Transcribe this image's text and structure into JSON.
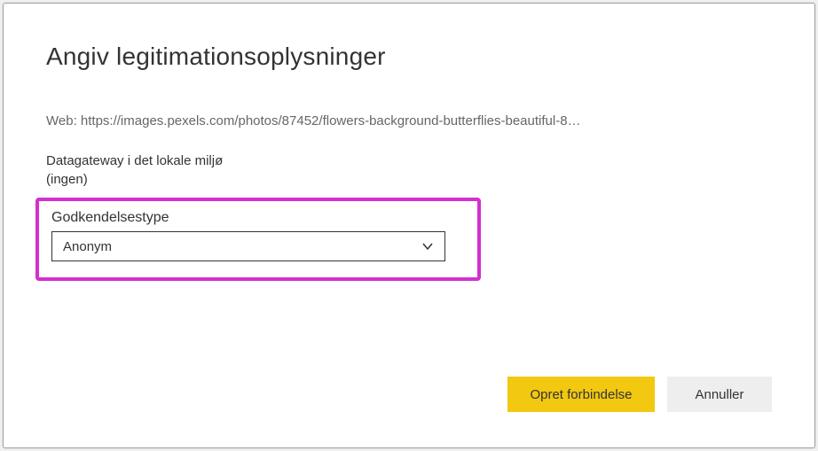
{
  "dialog": {
    "title": "Angiv legitimationsoplysninger",
    "source_prefix": "Web: ",
    "source_url": "https://images.pexels.com/photos/87452/flowers-background-butterflies-beautiful-8…",
    "gateway_label": "Datagateway i det lokale miljø",
    "gateway_value": "(ingen)",
    "auth_label": "Godkendelsestype",
    "auth_selected": "Anonym",
    "buttons": {
      "primary": "Opret forbindelse",
      "secondary": "Annuller"
    }
  }
}
